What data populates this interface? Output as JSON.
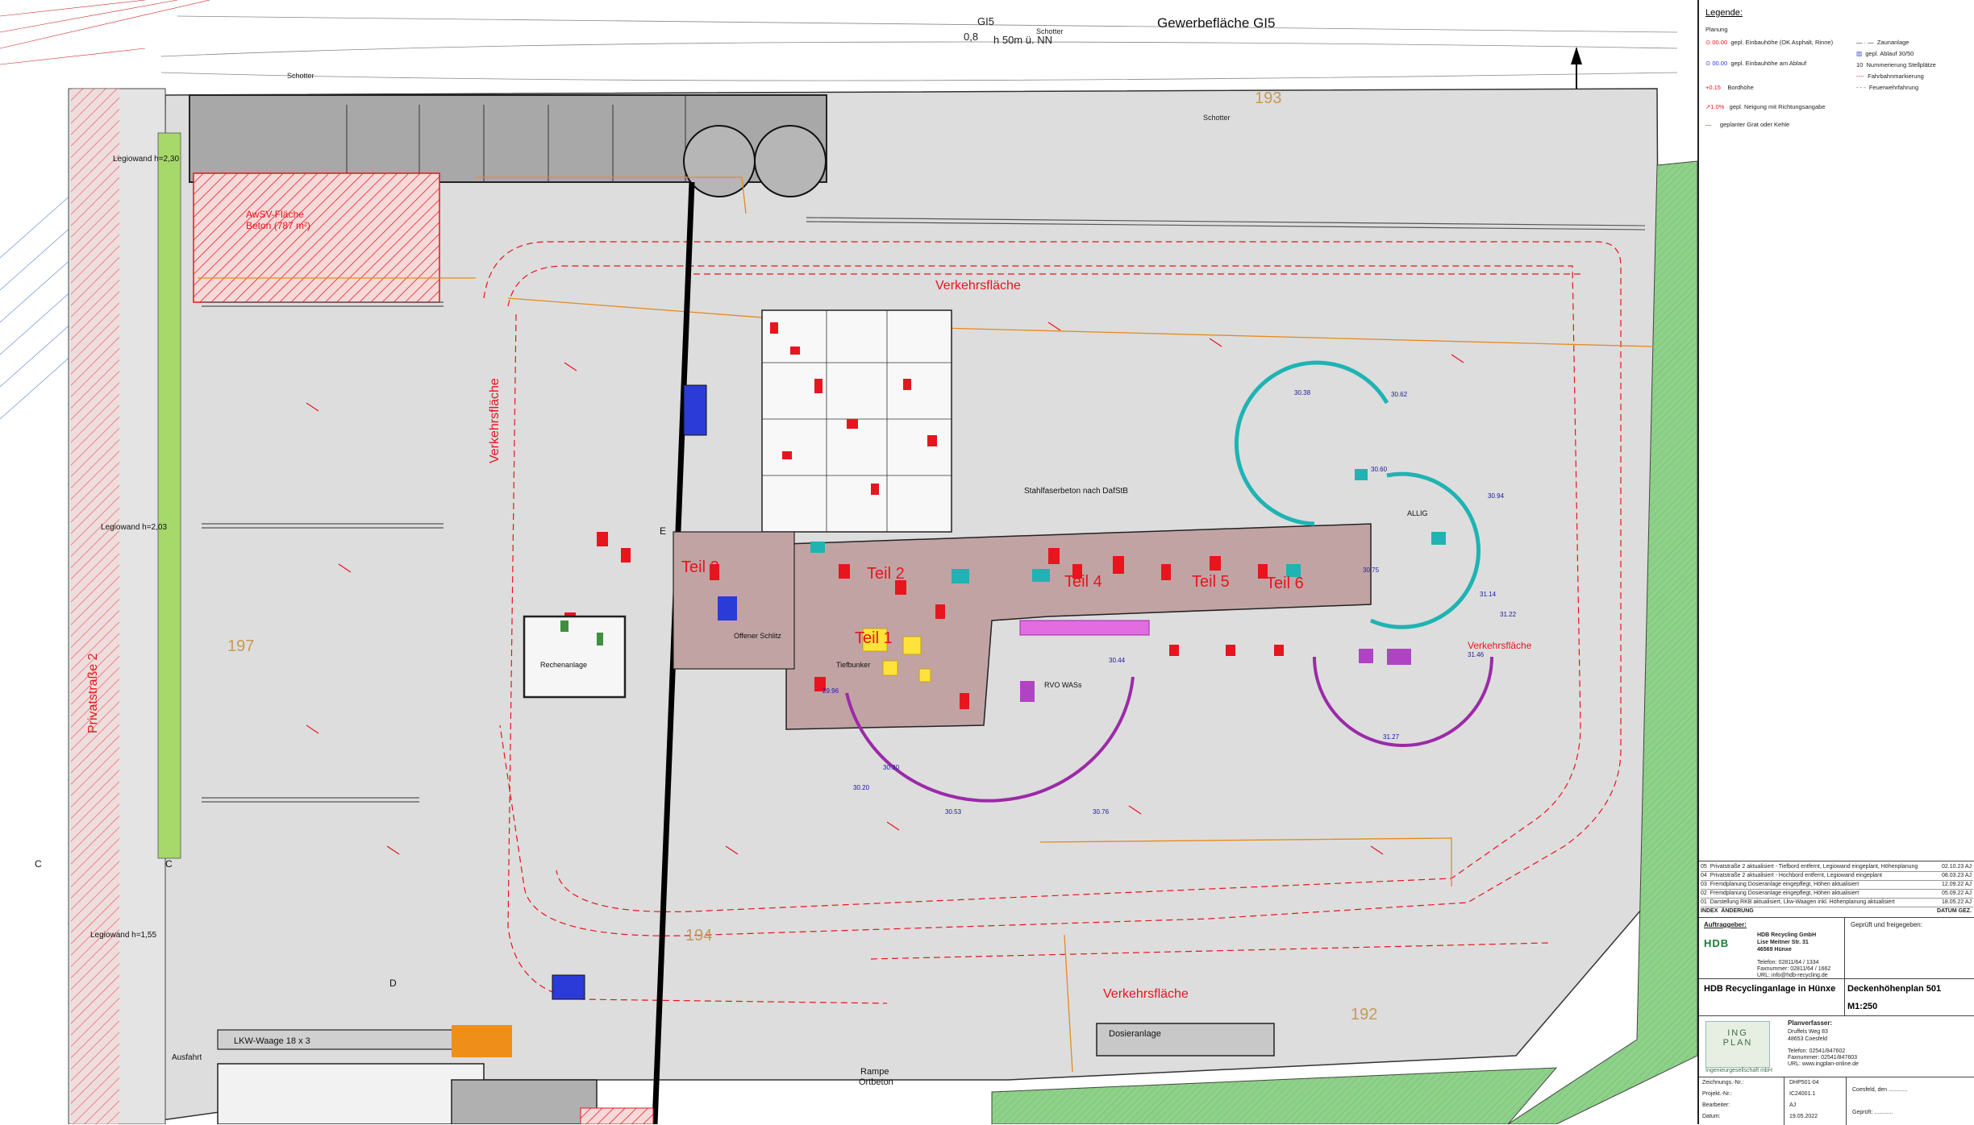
{
  "plan": {
    "header_area": "Gewerbefläche GI5",
    "gi5_label": "GI5",
    "gi5_value": "0,8",
    "gi5_height": "h 50m ü. NN",
    "north_label": "N",
    "parcel_numbers": [
      "193",
      "197",
      "194",
      "192"
    ],
    "traffic_label": "Verkehrsfläche",
    "traffic_label_vertical": "Verkehrsfläche",
    "private_road": "Privatstraße 2",
    "steel_note": "Stahlfaserbeton nach DafStB",
    "parts": [
      "Teil 1",
      "Teil 2",
      "Teil 3",
      "Teil 4",
      "Teil 5",
      "Teil 6"
    ],
    "awsv_label": "AwSV-Fläche",
    "awsv_area": "Beton (787 m²)",
    "lego_walls": [
      "Legiowand h=2,30",
      "Legiowand h=2,03",
      "Legiowand h=1,55"
    ],
    "lkw_label": "LKW-Waage 18 x 3",
    "ramp_label": "Rampe",
    "ramp_sub": "Ortbeton",
    "dosier_label": "Dosieranlage",
    "rechenanlage": "Rechenanlage",
    "offener_schlitz": "Offener Schlitz",
    "rvo_label": "RVO WASs",
    "allig_label": "ALLIG",
    "tiefbunker_label": "Tiefbunker",
    "ausfahrt": "Ausfahrt",
    "schotter": "Schotter",
    "section_marks": [
      "C",
      "C",
      "D",
      "E"
    ],
    "spot_heights_sample": [
      "30.38",
      "30.62",
      "30.60",
      "30.94",
      "31.14",
      "31.22",
      "30.75",
      "31.46",
      "31.27",
      "30.53",
      "30.76",
      "30.30",
      "30.20",
      "29.96",
      "30.44"
    ]
  },
  "titleblock": {
    "legend_title": "Legende:",
    "legend_planning": "Planung",
    "legend_items": [
      "gepl. Einbauhöhe (OK Asphalt, Rinne)",
      "gepl. Einbauhöhe am Ablauf",
      "Bordhöhe",
      "gepl. Neigung mit Richtungsangabe",
      "geplanter Grat oder Kehle"
    ],
    "legend_right": [
      "Zaunanlage",
      "gepl. Ablauf 30/50",
      "Nummerierung Stellplätze",
      "Fahrbahnmarkierung",
      "Feuerwehrfahrung"
    ],
    "revisions": [
      {
        "index": "05",
        "text": "Privatstraße 2 aktualisiert - Tiefbord entfernt, Legiowand eingeplant, Höhenplanung",
        "date": "02.10.23",
        "by": "AJ"
      },
      {
        "index": "04",
        "text": "Privatstraße 2 aktualisiert - Hochbord entfernt, Legiowand eingeplant",
        "date": "08.03.23",
        "by": "AJ"
      },
      {
        "index": "03",
        "text": "Fremdplanung Dosieranlage eingepflegt, Höhen aktualisiert",
        "date": "12.09.22",
        "by": "AJ"
      },
      {
        "index": "02",
        "text": "Fremdplanung Dosieranlage eingepflegt, Höhen aktualisiert",
        "date": "05.09.22",
        "by": "AJ"
      },
      {
        "index": "01",
        "text": "Darstellung RKB aktualisiert, Lkw-Waagen inkl. Höhenplanung aktualisiert",
        "date": "18.05.22",
        "by": "AJ"
      }
    ],
    "rev_header": [
      "INDEX",
      "ÄNDERUNG",
      "DATUM",
      "GEZ."
    ],
    "client_title": "Auftraggeber:",
    "client_logo": "HDB",
    "client_name": "HDB Recycling GmbH",
    "client_street": "Lise Meitner Str. 31",
    "client_city": "46569 Hünxe",
    "client_phone": "Telefon:   02811/64 / 1334",
    "client_fax": "Faxnummer: 02811/64 / 1662",
    "client_mail": "URL:   info@hdb-recycling.de",
    "approval": "Geprüft und freigegeben:",
    "project": "HDB Recyclinganlage in Hünxe",
    "plan_title": "Deckenhöhenplan 501",
    "scale": "M1:250",
    "designer_title": "Planverfasser:",
    "designer_street": "Druffels Weg 83",
    "designer_city": "48653 Coesfeld",
    "designer_phone": "Telefon:   02541/847602",
    "designer_fax": "Faxnummer: 02541/847603",
    "designer_url": "URL:   www.ingplan-online.de",
    "designer_logo_1": "ING",
    "designer_logo_2": "PLAN",
    "designer_sub": "Ingenieurgesellschaft mbH",
    "drawing_no_label": "Zeichnungs.-Nr.:",
    "drawing_no": "DHP501-04",
    "project_no_label": "Projekt.-Nr.:",
    "project_no": "IC24001.1",
    "editor_label": "Bearbeiter:",
    "editor": "AJ",
    "date_label": "Datum:",
    "date": "19.05.2022",
    "coesfeld": "Coesfeld, den ............",
    "checked": "Geprüft: ............"
  },
  "colors": {
    "ground": "#dcdcdc",
    "red": "#e8141e",
    "green": "#7fc97a",
    "teal": "#1fb3b3",
    "purple": "#9b2aa8",
    "brown": "#b8898a",
    "orange": "#e58a1f"
  }
}
